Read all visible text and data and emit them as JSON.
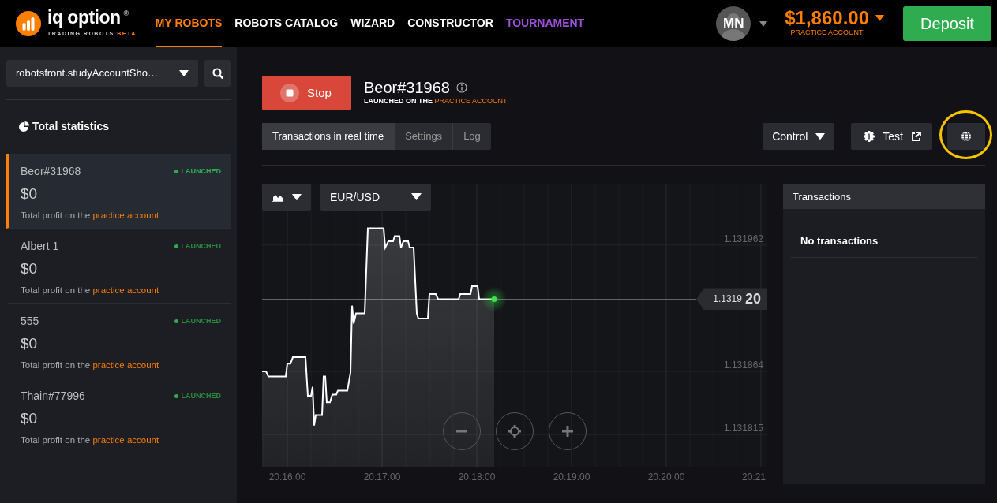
{
  "header": {
    "logo": {
      "wordmark": "iq option",
      "registered": "®",
      "subtitle": "TRADING ROBOTS",
      "subtitle_badge": "BETA"
    },
    "nav": [
      {
        "label": "MY ROBOTS",
        "selected": true,
        "kind": "link"
      },
      {
        "label": "ROBOTS CATALOG",
        "selected": false,
        "kind": "link"
      },
      {
        "label": "WIZARD",
        "selected": false,
        "kind": "link"
      },
      {
        "label": "CONSTRUCTOR",
        "selected": false,
        "kind": "link"
      },
      {
        "label": "TOURNAMENT",
        "selected": false,
        "kind": "promo"
      }
    ],
    "account": {
      "avatar_initials": "MN",
      "balance": "$1,860.00",
      "label": "PRACTICE ACCOUNT"
    },
    "deposit_button": "Deposit"
  },
  "sidebar": {
    "account_select": "robotsfront.studyAccountSho…",
    "total_statistics": "Total statistics",
    "robots": [
      {
        "name": "Beor#31968",
        "status": "LAUNCHED",
        "selected": true,
        "amount": "$0",
        "profit_text": "Total profit on the",
        "profit_link": "practice account"
      },
      {
        "name": "Albert 1",
        "status": "LAUNCHED",
        "selected": false,
        "amount": "$0",
        "profit_text": "Total profit on the",
        "profit_link": "practice account"
      },
      {
        "name": "555",
        "status": "LAUNCHED",
        "selected": false,
        "amount": "$0",
        "profit_text": "Total profit on the",
        "profit_link": "practice account"
      },
      {
        "name": "Thain#77996",
        "status": "LAUNCHED",
        "selected": false,
        "amount": "$0",
        "profit_text": "Total profit on the",
        "profit_link": "practice account"
      }
    ]
  },
  "robot": {
    "stop_button": "Stop",
    "title": "Beor#31968",
    "subtitle": "LAUNCHED ON THE",
    "subtitle_link": "PRACTICE ACCOUNT",
    "tabs": [
      {
        "label": "Transactions in real time",
        "selected": true
      },
      {
        "label": "Settings",
        "selected": false
      },
      {
        "label": "Log",
        "selected": false
      }
    ],
    "control_button": "Control",
    "test_button": "Test",
    "globe_button": {
      "highlighted": true
    }
  },
  "chart": {
    "pair_select": "EUR/USD",
    "price_tag": {
      "main": "1.1319",
      "big": "20"
    },
    "chart_data": {
      "type": "area",
      "x": [
        72944,
        72946.5,
        72948,
        72959,
        72960,
        72962,
        72963.5,
        72971.5,
        72973,
        72975,
        72976,
        72977,
        72978,
        72982,
        72983,
        72984,
        72985,
        72987,
        72988.5,
        72991,
        72992,
        72998,
        73000,
        73001,
        73002,
        73003.5,
        73009,
        73011,
        73021,
        73022,
        73024,
        73027,
        73028,
        73031,
        73032,
        73033.5,
        73036.5,
        73037.5,
        73040,
        73042,
        73043,
        73049,
        73050,
        73054,
        73055.5,
        73068.5,
        73069.5,
        73076,
        73077,
        73080.5,
        73081.5,
        73091
      ],
      "series": [
        {
          "color": "#ffffff",
          "values": [
            1.131864,
            1.131864,
            1.13186,
            1.13186,
            1.13187,
            1.13187,
            1.131875,
            1.131875,
            1.131845,
            1.131845,
            1.131852,
            1.131822,
            1.13183,
            1.13183,
            1.13186,
            1.13186,
            1.13184,
            1.13184,
            1.131846,
            1.131846,
            1.131849,
            1.131849,
            1.131863,
            1.131915,
            1.131901,
            1.131909,
            1.131909,
            1.131975,
            1.131975,
            1.13196,
            1.131965,
            1.131965,
            1.131969,
            1.131969,
            1.13196,
            1.131965,
            1.131965,
            1.13196,
            1.13196,
            1.131909,
            1.131905,
            1.131905,
            1.131924,
            1.131924,
            1.13192,
            1.13192,
            1.131924,
            1.131924,
            1.13193,
            1.13193,
            1.13192,
            1.13192
          ]
        }
      ],
      "xlim": [
        72944,
        73264
      ],
      "ylim": [
        1.13179,
        1.132009
      ],
      "xticks": [
        {
          "value": 72960,
          "label": "20:16:00"
        },
        {
          "value": 73020,
          "label": "20:17:00"
        },
        {
          "value": 73080,
          "label": "20:18:00"
        },
        {
          "value": 73140,
          "label": "20:19:00"
        },
        {
          "value": 73200,
          "label": "20:20:00"
        },
        {
          "value": 73260,
          "label": "20:21"
        }
      ],
      "yticks": [
        1.131815,
        1.131864,
        1.131962
      ],
      "grid": true,
      "ref_lines": [
        {
          "axis": "y",
          "value": 1.13192
        }
      ]
    }
  },
  "transactions": {
    "title": "Transactions",
    "empty_text": "No transactions"
  }
}
